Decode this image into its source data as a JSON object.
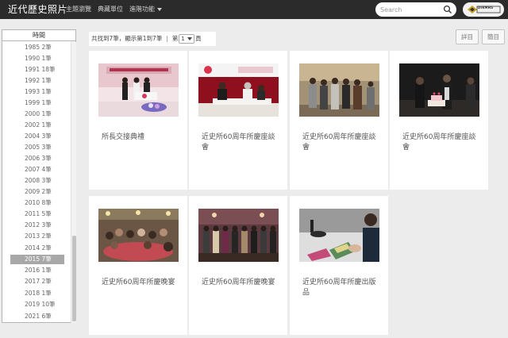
{
  "navbar": {
    "brand": "近代歷史照片",
    "links": [
      "主題瀏覽",
      "典藏單位",
      "進階功能"
    ],
    "search_placeholder": "Search",
    "logo_text": "DIRMHS"
  },
  "sidebar": {
    "title": "時間",
    "years": [
      {
        "label": "1985 2筆"
      },
      {
        "label": "1990 1筆"
      },
      {
        "label": "1991 18筆"
      },
      {
        "label": "1992 1筆"
      },
      {
        "label": "1993 1筆"
      },
      {
        "label": "1999 1筆"
      },
      {
        "label": "2000 1筆"
      },
      {
        "label": "2002 1筆"
      },
      {
        "label": "2004 3筆"
      },
      {
        "label": "2005 3筆"
      },
      {
        "label": "2006 3筆"
      },
      {
        "label": "2007 4筆"
      },
      {
        "label": "2008 3筆"
      },
      {
        "label": "2009 2筆"
      },
      {
        "label": "2010 8筆"
      },
      {
        "label": "2011 5筆"
      },
      {
        "label": "2012 3筆"
      },
      {
        "label": "2013 2筆"
      },
      {
        "label": "2014 2筆"
      },
      {
        "label": "2015 7筆",
        "selected": true
      },
      {
        "label": "2016 1筆"
      },
      {
        "label": "2017 2筆"
      },
      {
        "label": "2018 1筆"
      },
      {
        "label": "2019 10筆"
      },
      {
        "label": "2021 6筆"
      }
    ]
  },
  "results": {
    "summary": "共找到7筆，顯示第1到7筆",
    "page_prefix": "第",
    "page_value": "1",
    "page_suffix": "頁"
  },
  "view_buttons": {
    "list": "詳目",
    "compact": "簡目"
  },
  "cards": [
    {
      "caption": "所長交接典禮",
      "scene": "ceremony"
    },
    {
      "caption": "近史所60周年所慶座談會",
      "scene": "forum-stage"
    },
    {
      "caption": "近史所60周年所慶座談會",
      "scene": "group-standing"
    },
    {
      "caption": "近史所60周年所慶座談會",
      "scene": "cake"
    },
    {
      "caption": "近史所60周年所慶晚宴",
      "scene": "banquet"
    },
    {
      "caption": "近史所60周年所慶晚宴",
      "scene": "group-photo"
    },
    {
      "caption": "近史所60周年所慶出版品",
      "scene": "publication"
    }
  ]
}
